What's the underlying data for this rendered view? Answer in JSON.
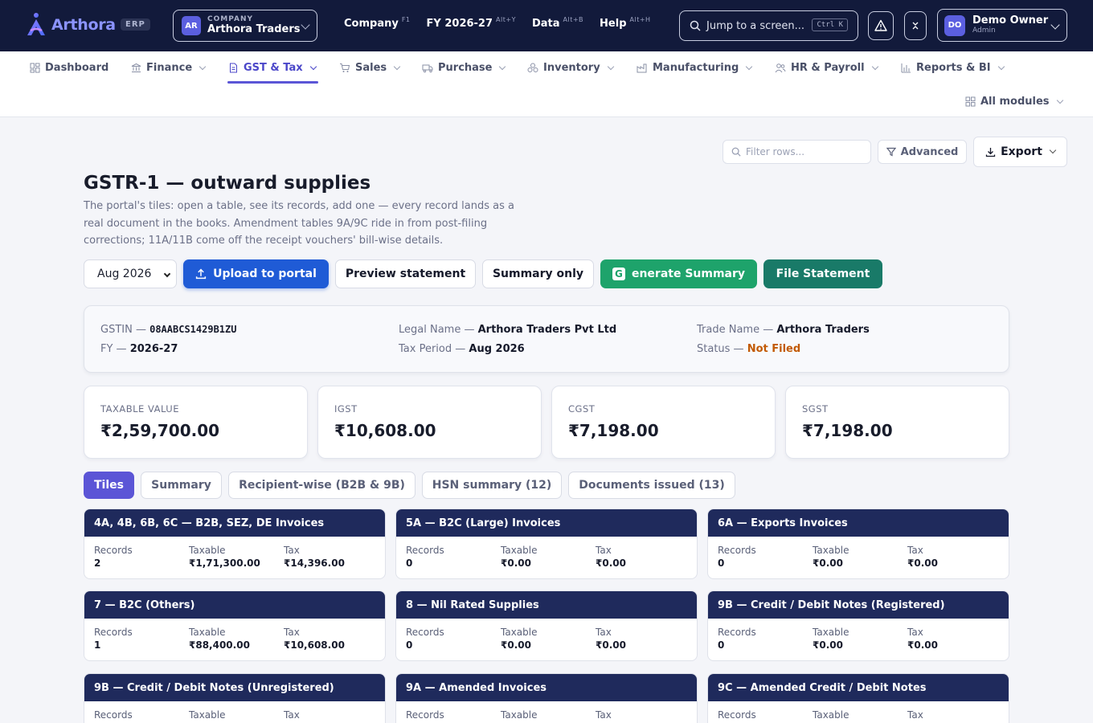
{
  "topbar": {
    "brand": "Arthora",
    "badge": "ERP",
    "company_caption": "COMPANY",
    "company_name": "Arthora Traders",
    "company_initials": "AR",
    "menu": [
      {
        "label": "Company",
        "key": "F1"
      },
      {
        "label": "FY 2026-27",
        "key": "Alt+Y"
      },
      {
        "label": "Data",
        "key": "Alt+B"
      },
      {
        "label": "Help",
        "key": "Alt+H"
      }
    ],
    "search_placeholder": "Jump to a screen...",
    "search_shortcut": "Ctrl K",
    "user_initials": "DO",
    "user_name": "Demo Owner",
    "user_role": "Admin"
  },
  "modules": [
    {
      "label": "Dashboard",
      "icon": "dashboard-icon"
    },
    {
      "label": "Finance",
      "icon": "bank-icon"
    },
    {
      "label": "GST & Tax",
      "icon": "document-icon",
      "active": true
    },
    {
      "label": "Sales",
      "icon": "cart-icon"
    },
    {
      "label": "Purchase",
      "icon": "truck-icon"
    },
    {
      "label": "Inventory",
      "icon": "boxes-icon"
    },
    {
      "label": "Manufacturing",
      "icon": "factory-icon"
    },
    {
      "label": "HR & Payroll",
      "icon": "users-icon"
    },
    {
      "label": "Reports & BI",
      "icon": "bar-chart-icon"
    },
    {
      "label": "All modules",
      "icon": "grid-icon"
    }
  ],
  "toolbar": {
    "filter_placeholder": "Filter rows...",
    "advanced": "Advanced",
    "export": "Export"
  },
  "page": {
    "title": "GSTR-1 — outward supplies",
    "description": "The portal's tiles: open a table, see its records, add one — every record lands as a real document in the books. Amendment tables 9A/9C ride in from post-filing corrections; 11A/11B come off the receipt vouchers' bill-wise details."
  },
  "actions": {
    "period": "Aug 2026",
    "upload": "Upload to portal",
    "preview": "Preview statement",
    "summary_only": "Summary only",
    "generate_badge": "G",
    "generate": "enerate Summary",
    "file": "File Statement"
  },
  "info": {
    "gstin_label": "GSTIN —",
    "gstin": "08AABCS1429B1ZU",
    "fy_label": "FY —",
    "fy": "2026-27",
    "legal_label": "Legal Name —",
    "legal": "Arthora Traders Pvt Ltd",
    "period_label": "Tax Period —",
    "period": "Aug 2026",
    "trade_label": "Trade Name —",
    "trade": "Arthora Traders",
    "status_label": "Status —",
    "status": "Not Filed",
    "status_color": "#c25a05"
  },
  "stats": [
    {
      "label": "TAXABLE VALUE",
      "value": "₹2,59,700.00"
    },
    {
      "label": "IGST",
      "value": "₹10,608.00"
    },
    {
      "label": "CGST",
      "value": "₹7,198.00"
    },
    {
      "label": "SGST",
      "value": "₹7,198.00"
    }
  ],
  "tabs": [
    {
      "label": "Tiles",
      "active": true
    },
    {
      "label": "Summary"
    },
    {
      "label": "Recipient-wise (B2B & 9B)"
    },
    {
      "label": "HSN summary (12)"
    },
    {
      "label": "Documents issued (13)"
    }
  ],
  "tile_labels": {
    "records": "Records",
    "taxable": "Taxable",
    "tax": "Tax"
  },
  "tiles": [
    {
      "title": "4A, 4B, 6B, 6C — B2B, SEZ, DE Invoices",
      "records": "2",
      "taxable": "₹1,71,300.00",
      "tax": "₹14,396.00"
    },
    {
      "title": "5A — B2C (Large) Invoices",
      "records": "0",
      "taxable": "₹0.00",
      "tax": "₹0.00"
    },
    {
      "title": "6A — Exports Invoices",
      "records": "0",
      "taxable": "₹0.00",
      "tax": "₹0.00"
    },
    {
      "title": "7 — B2C (Others)",
      "records": "1",
      "taxable": "₹88,400.00",
      "tax": "₹10,608.00"
    },
    {
      "title": "8 — Nil Rated Supplies",
      "records": "0",
      "taxable": "₹0.00",
      "tax": "₹0.00"
    },
    {
      "title": "9B — Credit / Debit Notes (Registered)",
      "records": "0",
      "taxable": "₹0.00",
      "tax": "₹0.00"
    },
    {
      "title": "9B — Credit / Debit Notes (Unregistered)",
      "records": "",
      "taxable": "",
      "tax": ""
    },
    {
      "title": "9A — Amended Invoices",
      "records": "",
      "taxable": "",
      "tax": ""
    },
    {
      "title": "9C — Amended Credit / Debit Notes",
      "records": "",
      "taxable": "",
      "tax": ""
    }
  ],
  "colors": {
    "topbar": "#121a3b",
    "accent": "#5b55d6",
    "upload": "#1f5bd6",
    "generate": "#1ea36b",
    "file": "#197a68",
    "tile_header": "#1f2a5c"
  }
}
